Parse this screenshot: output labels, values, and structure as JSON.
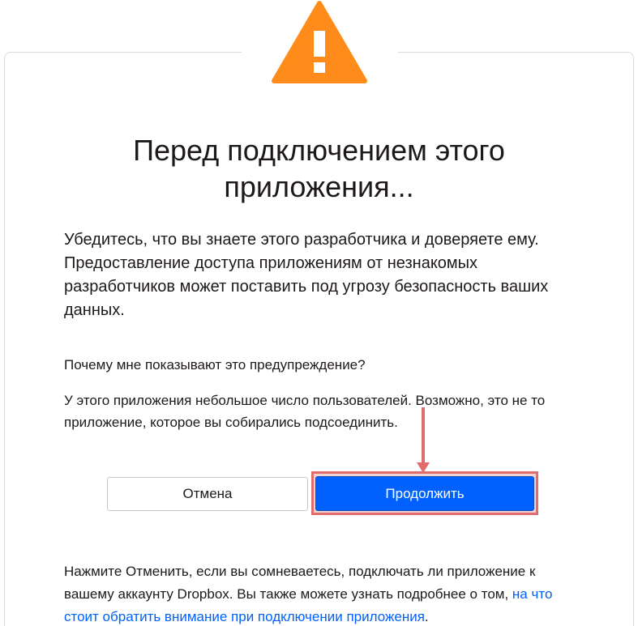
{
  "dialog": {
    "title": "Перед подключением этого приложения...",
    "lead": "Убедитесь, что вы знаете этого разработчика и доверяете ему. Предоставление доступа приложениям от незнакомых разработчиков может поставить под угрозу безопасность ваших данных.",
    "why_heading": "Почему мне показывают это предупреждение?",
    "why_text": "У этого приложения небольшое число пользователей. Возможно, это не то приложение, которое вы собирались подсоединить.",
    "cancel_label": "Отмена",
    "continue_label": "Продолжить",
    "footer_prefix": "Нажмите Отменить, если вы сомневаетесь, подключать ли приложение к вашему аккаунту Dropbox. Вы также можете узнать подробнее о том, ",
    "footer_link": "на что стоит обратить внимание при подключении приложения",
    "footer_suffix": "."
  },
  "icons": {
    "warning": "warning-triangle-icon",
    "annotation": "arrow-down-annotation"
  },
  "colors": {
    "warning": "#ff8c1a",
    "primary": "#0061fe",
    "link": "#0061fe",
    "annotation": "#e06c6c",
    "text": "#1e1919"
  }
}
